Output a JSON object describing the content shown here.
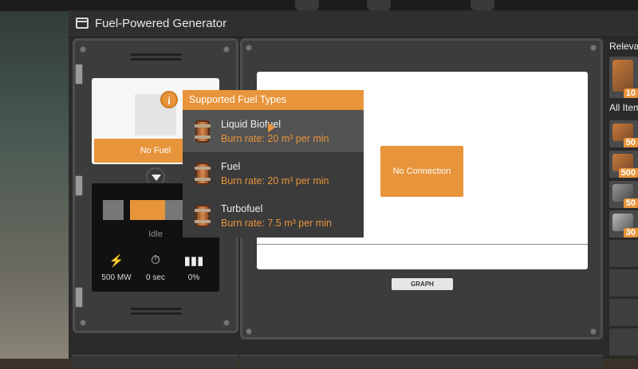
{
  "window": {
    "title": "Fuel-Powered Generator"
  },
  "fuel": {
    "button_label": "No Fuel",
    "info_label": "i"
  },
  "status": {
    "state": "Idle",
    "power": "500 MW",
    "time": "0 sec",
    "productivity": "0%"
  },
  "popup": {
    "title": "Supported Fuel Types",
    "items": [
      {
        "name": "Liquid Biofuel",
        "rate": "Burn rate: 20 m³ per min"
      },
      {
        "name": "Fuel",
        "rate": "Burn rate: 20 m³ per min"
      },
      {
        "name": "Turbofuel",
        "rate": "Burn rate: 7.5 m³ per min"
      }
    ]
  },
  "graph": {
    "no_connection": "No Connection",
    "button_label": "GRAPH"
  },
  "sidebar": {
    "relevant_label": "Relevant",
    "all_items_label": "All Items",
    "items": [
      {
        "count": "10"
      },
      {
        "count": "50"
      },
      {
        "count": "500"
      },
      {
        "count": "50"
      },
      {
        "count": "30"
      }
    ]
  },
  "colors": {
    "accent": "#e8943a",
    "panel": "#3c3c3c",
    "popup": "#3b3b3b"
  }
}
